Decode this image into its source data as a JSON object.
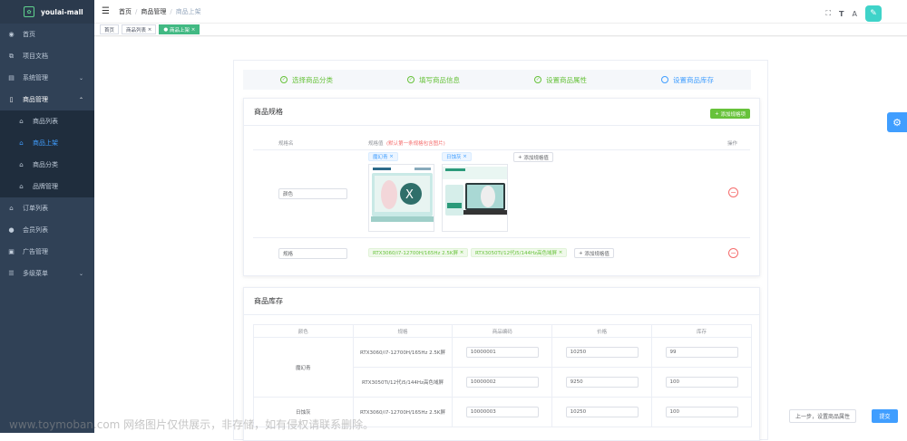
{
  "app": {
    "name": "youlai-mall",
    "logo_glyph": "✿"
  },
  "sidebar": {
    "items": [
      {
        "label": "首页",
        "icon": "dashboard-icon"
      },
      {
        "label": "项目文档",
        "icon": "external-link-icon"
      },
      {
        "label": "系统管理",
        "icon": "system-icon"
      },
      {
        "label": "商品管理",
        "icon": "mobile-icon",
        "sub": [
          {
            "label": "商品列表"
          },
          {
            "label": "商品上架",
            "active": true
          },
          {
            "label": "商品分类"
          },
          {
            "label": "品牌管理"
          }
        ]
      },
      {
        "label": "订单列表",
        "icon": "order-icon"
      },
      {
        "label": "会员列表",
        "icon": "user-icon"
      },
      {
        "label": "广告管理",
        "icon": "ad-icon"
      },
      {
        "label": "多级菜单",
        "icon": "menu-icon"
      }
    ]
  },
  "header": {
    "breadcrumb": [
      "首页",
      "商品管理",
      "商品上架"
    ],
    "sep": "/"
  },
  "tags": [
    "首页",
    "商品列表",
    "商品上架"
  ],
  "steps": [
    "选择商品分类",
    "填写商品信息",
    "设置商品属性",
    "设置商品库存"
  ],
  "spec": {
    "title": "商品规格",
    "add_label": "添加规格项",
    "col_name": "规格名",
    "col_value": "规格值",
    "col_value_tip": "(默认第一条规格包含图片)",
    "col_op": "操作",
    "rows": [
      {
        "name": "颜色",
        "values": [
          "魔幻青",
          "日蚀灰"
        ],
        "add": "添加规格值"
      },
      {
        "name": "规格",
        "values": [
          "RTX3060/i7-12700H/165Hz 2.5K屏",
          "RTX3050Ti/12代i5/144Hz高色域屏"
        ],
        "add": "添加规格值"
      }
    ]
  },
  "stock": {
    "title": "商品库存",
    "headers": [
      "颜色",
      "规格",
      "商品编码",
      "价格",
      "库存"
    ],
    "rows": [
      {
        "color": "魔幻青",
        "spec": "RTX3060/i7-12700H/165Hz 2.5K屏",
        "code": "10000001",
        "price": "10250",
        "stock": "99"
      },
      {
        "color": "",
        "spec": "RTX3050Ti/12代i5/144Hz高色域屏",
        "code": "10000002",
        "price": "9250",
        "stock": "100"
      },
      {
        "color": "日蚀灰",
        "spec": "RTX3060/i7-12700H/165Hz 2.5K屏",
        "code": "10000003",
        "price": "10250",
        "stock": "100"
      }
    ]
  },
  "footer": {
    "prev": "上一步，设置商品属性",
    "submit": "提交"
  },
  "watermark": "www.toymoban.com 网络图片仅供展示，非存储，如有侵权请联系删除。",
  "colors": {
    "sidebar": "#304156",
    "accent": "#409eff",
    "success": "#67c23a",
    "danger": "#f56c6c"
  }
}
